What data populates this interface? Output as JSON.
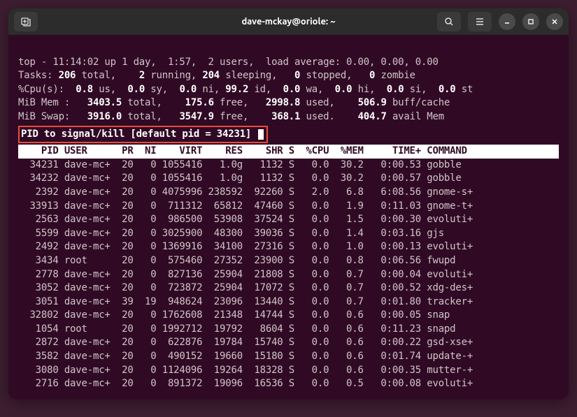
{
  "window": {
    "title": "dave-mckay@oriole: ~"
  },
  "top_summary": {
    "line1_pre": "top - 11:14:02 up 1 day,  1:57,  2 users,  load average: 0.00, 0.00, 0.00",
    "line2": {
      "prefix": "Tasks:",
      "total": " 206 ",
      "total_lbl": "total,   ",
      "running": " 2 ",
      "running_lbl": "running,",
      "sleeping": " 204 ",
      "sleeping_lbl": "sleeping,  ",
      "stopped": " 0 ",
      "stopped_lbl": "stopped,  ",
      "zombie": " 0 ",
      "zombie_lbl": "zombie"
    },
    "line3": {
      "prefix": "%Cpu(s): ",
      "us": " 0.8 ",
      "us_lbl": "us, ",
      "sy": " 0.0 ",
      "sy_lbl": "sy, ",
      "ni": " 0.0 ",
      "ni_lbl": "ni,",
      "id": " 99.2 ",
      "id_lbl": "id, ",
      "wa": " 0.0 ",
      "wa_lbl": "wa, ",
      "hi": " 0.0 ",
      "hi_lbl": "hi, ",
      "si": " 0.0 ",
      "si_lbl": "si, ",
      "st": " 0.0 ",
      "st_lbl": "st"
    },
    "line4": {
      "prefix": "MiB Mem :  ",
      "total": " 3403.5 ",
      "total_lbl": "total,   ",
      "free": " 175.6 ",
      "free_lbl": "free,   ",
      "used": "2998.8 ",
      "used_lbl": "used,    ",
      "buff": "506.9 ",
      "buff_lbl": "buff/cache"
    },
    "line5": {
      "prefix": "MiB Swap:  ",
      "total": " 3916.0 ",
      "total_lbl": "total,  ",
      "free": " 3547.9 ",
      "free_lbl": "free,    ",
      "used": "368.1 ",
      "used_lbl": "used.    ",
      "avail": "404.7 ",
      "avail_lbl": "avail Mem"
    }
  },
  "kill_prompt": "PID to signal/kill [default pid = 34231]",
  "headers": "    PID USER      PR  NI    VIRT    RES    SHR S  %CPU  %MEM     TIME+ COMMAND  ",
  "processes": [
    {
      "pid": "34231",
      "user": "dave-mc+",
      "pr": "20",
      "ni": "0",
      "virt": "1055416",
      "res": "1.0g",
      "shr": "1132",
      "s": "S",
      "cpu": "0.0",
      "mem": "30.2",
      "time": "0:00.53",
      "cmd": "gobble"
    },
    {
      "pid": "34232",
      "user": "dave-mc+",
      "pr": "20",
      "ni": "0",
      "virt": "1055416",
      "res": "1.0g",
      "shr": "1132",
      "s": "S",
      "cpu": "0.0",
      "mem": "30.2",
      "time": "0:00.57",
      "cmd": "gobble"
    },
    {
      "pid": "2392",
      "user": "dave-mc+",
      "pr": "20",
      "ni": "0",
      "virt": "4075996",
      "res": "238592",
      "shr": "92260",
      "s": "S",
      "cpu": "2.0",
      "mem": "6.8",
      "time": "6:08.56",
      "cmd": "gnome-s+"
    },
    {
      "pid": "33913",
      "user": "dave-mc+",
      "pr": "20",
      "ni": "0",
      "virt": "711312",
      "res": "65812",
      "shr": "47460",
      "s": "S",
      "cpu": "0.0",
      "mem": "1.9",
      "time": "0:11.03",
      "cmd": "gnome-t+"
    },
    {
      "pid": "2563",
      "user": "dave-mc+",
      "pr": "20",
      "ni": "0",
      "virt": "986500",
      "res": "53908",
      "shr": "37524",
      "s": "S",
      "cpu": "0.0",
      "mem": "1.5",
      "time": "0:00.30",
      "cmd": "evoluti+"
    },
    {
      "pid": "5599",
      "user": "dave-mc+",
      "pr": "20",
      "ni": "0",
      "virt": "3025900",
      "res": "48300",
      "shr": "39036",
      "s": "S",
      "cpu": "0.0",
      "mem": "1.4",
      "time": "0:03.16",
      "cmd": "gjs"
    },
    {
      "pid": "2492",
      "user": "dave-mc+",
      "pr": "20",
      "ni": "0",
      "virt": "1369916",
      "res": "34100",
      "shr": "27316",
      "s": "S",
      "cpu": "0.0",
      "mem": "1.0",
      "time": "0:00.13",
      "cmd": "evoluti+"
    },
    {
      "pid": "3434",
      "user": "root",
      "pr": "20",
      "ni": "0",
      "virt": "575460",
      "res": "27352",
      "shr": "23900",
      "s": "S",
      "cpu": "0.0",
      "mem": "0.8",
      "time": "0:06.56",
      "cmd": "fwupd"
    },
    {
      "pid": "2778",
      "user": "dave-mc+",
      "pr": "20",
      "ni": "0",
      "virt": "827136",
      "res": "25904",
      "shr": "21808",
      "s": "S",
      "cpu": "0.0",
      "mem": "0.7",
      "time": "0:00.04",
      "cmd": "evoluti+"
    },
    {
      "pid": "3052",
      "user": "dave-mc+",
      "pr": "20",
      "ni": "0",
      "virt": "723872",
      "res": "25904",
      "shr": "17072",
      "s": "S",
      "cpu": "0.0",
      "mem": "0.7",
      "time": "0:00.52",
      "cmd": "xdg-des+"
    },
    {
      "pid": "3051",
      "user": "dave-mc+",
      "pr": "39",
      "ni": "19",
      "virt": "948624",
      "res": "23096",
      "shr": "13440",
      "s": "S",
      "cpu": "0.0",
      "mem": "0.7",
      "time": "0:01.80",
      "cmd": "tracker+"
    },
    {
      "pid": "32802",
      "user": "dave-mc+",
      "pr": "20",
      "ni": "0",
      "virt": "1762608",
      "res": "21348",
      "shr": "14744",
      "s": "S",
      "cpu": "0.0",
      "mem": "0.6",
      "time": "0:00.05",
      "cmd": "snap"
    },
    {
      "pid": "1054",
      "user": "root",
      "pr": "20",
      "ni": "0",
      "virt": "1992712",
      "res": "19792",
      "shr": "8604",
      "s": "S",
      "cpu": "0.0",
      "mem": "0.6",
      "time": "0:11.23",
      "cmd": "snapd"
    },
    {
      "pid": "2872",
      "user": "dave-mc+",
      "pr": "20",
      "ni": "0",
      "virt": "622876",
      "res": "19784",
      "shr": "15740",
      "s": "S",
      "cpu": "0.0",
      "mem": "0.6",
      "time": "0:00.22",
      "cmd": "gsd-xse+"
    },
    {
      "pid": "3582",
      "user": "dave-mc+",
      "pr": "20",
      "ni": "0",
      "virt": "490152",
      "res": "19660",
      "shr": "15180",
      "s": "S",
      "cpu": "0.0",
      "mem": "0.6",
      "time": "0:01.74",
      "cmd": "update-+"
    },
    {
      "pid": "3080",
      "user": "dave-mc+",
      "pr": "20",
      "ni": "0",
      "virt": "1124096",
      "res": "19264",
      "shr": "18328",
      "s": "S",
      "cpu": "0.0",
      "mem": "0.6",
      "time": "0:00.35",
      "cmd": "mutter-+"
    },
    {
      "pid": "2716",
      "user": "dave-mc+",
      "pr": "20",
      "ni": "0",
      "virt": "891372",
      "res": "19096",
      "shr": "16536",
      "s": "S",
      "cpu": "0.0",
      "mem": "0.5",
      "time": "0:00.08",
      "cmd": "evoluti+"
    }
  ]
}
